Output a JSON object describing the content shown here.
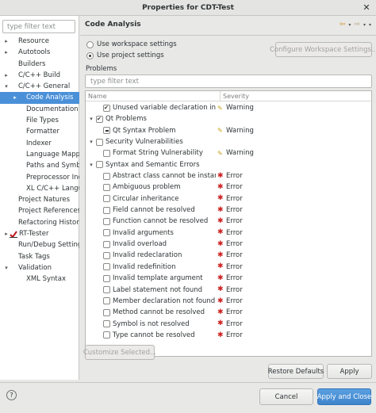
{
  "window": {
    "title": "Properties for CDT-Test",
    "close_glyph": "✕"
  },
  "left": {
    "filter_placeholder": "type filter text",
    "tree": [
      {
        "label": "Resource",
        "depth": 0,
        "expander": "▸"
      },
      {
        "label": "Autotools",
        "depth": 0,
        "expander": "▸"
      },
      {
        "label": "Builders",
        "depth": 0,
        "expander": ""
      },
      {
        "label": "C/C++ Build",
        "depth": 0,
        "expander": "▸"
      },
      {
        "label": "C/C++ General",
        "depth": 0,
        "expander": "▾"
      },
      {
        "label": "Code Analysis",
        "depth": 1,
        "expander": "▸",
        "selected": true
      },
      {
        "label": "Documentation",
        "depth": 1,
        "expander": ""
      },
      {
        "label": "File Types",
        "depth": 1,
        "expander": ""
      },
      {
        "label": "Formatter",
        "depth": 1,
        "expander": ""
      },
      {
        "label": "Indexer",
        "depth": 1,
        "expander": ""
      },
      {
        "label": "Language Mappings",
        "depth": 1,
        "expander": ""
      },
      {
        "label": "Paths and Symbols",
        "depth": 1,
        "expander": ""
      },
      {
        "label": "Preprocessor Include Paths",
        "depth": 1,
        "expander": ""
      },
      {
        "label": "XL C/C++ Language Options",
        "depth": 1,
        "expander": ""
      },
      {
        "label": "Project Natures",
        "depth": 0,
        "expander": ""
      },
      {
        "label": "Project References",
        "depth": 0,
        "expander": ""
      },
      {
        "label": "Refactoring History",
        "depth": 0,
        "expander": ""
      },
      {
        "label": "RT-Tester",
        "depth": 0,
        "expander": "▸",
        "icon": "rt-tester-icon"
      },
      {
        "label": "Run/Debug Settings",
        "depth": 0,
        "expander": ""
      },
      {
        "label": "Task Tags",
        "depth": 0,
        "expander": ""
      },
      {
        "label": "Validation",
        "depth": 0,
        "expander": "▾"
      },
      {
        "label": "XML Syntax",
        "depth": 1,
        "expander": ""
      }
    ]
  },
  "right": {
    "title": "Code Analysis",
    "nav": {
      "back": "⇦",
      "forward": "⇨",
      "dropdown": "▾",
      "menu": "▾"
    },
    "radio_workspace": "Use workspace settings",
    "radio_project": "Use project settings",
    "configure_button": "Configure Workspace Settings...",
    "problems_label": "Problems",
    "filter_placeholder": "type filter text",
    "columns": {
      "name": "Name",
      "severity": "Severity"
    },
    "rows": [
      {
        "kind": "item",
        "name": "Unused variable declaration in file scope",
        "severity": "Warning",
        "sev": "warning",
        "check": "check"
      },
      {
        "kind": "group",
        "name": "Qt Problems",
        "expander": "▾",
        "check": "check"
      },
      {
        "kind": "item",
        "name": "Qt Syntax Problem",
        "severity": "Warning",
        "sev": "warning",
        "check": "dash"
      },
      {
        "kind": "group",
        "name": "Security Vulnerabilities",
        "expander": "▾",
        "check": "none"
      },
      {
        "kind": "item",
        "name": "Format String Vulnerability",
        "severity": "Warning",
        "sev": "warning",
        "check": "none"
      },
      {
        "kind": "group",
        "name": "Syntax and Semantic Errors",
        "expander": "▾",
        "check": "none"
      },
      {
        "kind": "item",
        "name": "Abstract class cannot be instantiated",
        "severity": "Error",
        "sev": "error",
        "check": "none"
      },
      {
        "kind": "item",
        "name": "Ambiguous problem",
        "severity": "Error",
        "sev": "error",
        "check": "none"
      },
      {
        "kind": "item",
        "name": "Circular inheritance",
        "severity": "Error",
        "sev": "error",
        "check": "none"
      },
      {
        "kind": "item",
        "name": "Field cannot be resolved",
        "severity": "Error",
        "sev": "error",
        "check": "none"
      },
      {
        "kind": "item",
        "name": "Function cannot be resolved",
        "severity": "Error",
        "sev": "error",
        "check": "none"
      },
      {
        "kind": "item",
        "name": "Invalid arguments",
        "severity": "Error",
        "sev": "error",
        "check": "none"
      },
      {
        "kind": "item",
        "name": "Invalid overload",
        "severity": "Error",
        "sev": "error",
        "check": "none"
      },
      {
        "kind": "item",
        "name": "Invalid redeclaration",
        "severity": "Error",
        "sev": "error",
        "check": "none"
      },
      {
        "kind": "item",
        "name": "Invalid redefinition",
        "severity": "Error",
        "sev": "error",
        "check": "none"
      },
      {
        "kind": "item",
        "name": "Invalid template argument",
        "severity": "Error",
        "sev": "error",
        "check": "none"
      },
      {
        "kind": "item",
        "name": "Label statement not found",
        "severity": "Error",
        "sev": "error",
        "check": "none"
      },
      {
        "kind": "item",
        "name": "Member declaration not found",
        "severity": "Error",
        "sev": "error",
        "check": "none"
      },
      {
        "kind": "item",
        "name": "Method cannot be resolved",
        "severity": "Error",
        "sev": "error",
        "check": "none"
      },
      {
        "kind": "item",
        "name": "Symbol is not resolved",
        "severity": "Error",
        "sev": "error",
        "check": "none"
      },
      {
        "kind": "item",
        "name": "Type cannot be resolved",
        "severity": "Error",
        "sev": "error",
        "check": "none"
      }
    ],
    "customize_button": "Customize Selected...",
    "restore_button": "Restore Defaults",
    "apply_button": "Apply"
  },
  "footer": {
    "help_glyph": "?",
    "cancel_button": "Cancel",
    "apply_close_button": "Apply and Close"
  },
  "colors": {
    "selection": "#4a90d9",
    "warning": "#c9a01a",
    "error": "#cc2222",
    "accent_button": "#3f85cc"
  }
}
